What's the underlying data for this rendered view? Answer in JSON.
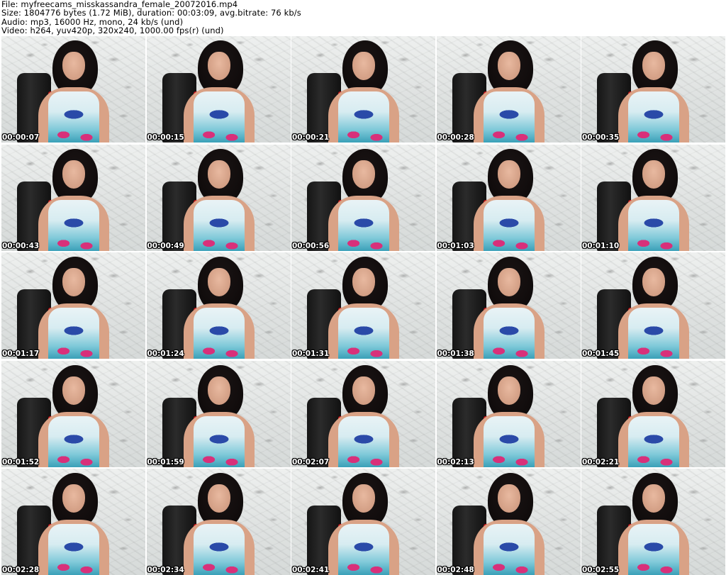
{
  "header": {
    "file_line": "File: myfreecams_misskassandra_female_20072016.mp4",
    "size_line": "Size: 1804776 bytes (1.72 MiB), duration: 00:03:09, avg.bitrate: 76 kb/s",
    "audio_line": "Audio: mp3, 16000 Hz, mono, 24 kb/s (und)",
    "video_line": "Video: h264, yuv420p, 320x240, 1000.00 fps(r) (und)"
  },
  "thumbnails": [
    {
      "timestamp": "00:00:07"
    },
    {
      "timestamp": "00:00:15"
    },
    {
      "timestamp": "00:00:21"
    },
    {
      "timestamp": "00:00:28"
    },
    {
      "timestamp": "00:00:35"
    },
    {
      "timestamp": "00:00:43"
    },
    {
      "timestamp": "00:00:49"
    },
    {
      "timestamp": "00:00:56"
    },
    {
      "timestamp": "00:01:03"
    },
    {
      "timestamp": "00:01:10"
    },
    {
      "timestamp": "00:01:17"
    },
    {
      "timestamp": "00:01:24"
    },
    {
      "timestamp": "00:01:31"
    },
    {
      "timestamp": "00:01:38"
    },
    {
      "timestamp": "00:01:45"
    },
    {
      "timestamp": "00:01:52"
    },
    {
      "timestamp": "00:01:59"
    },
    {
      "timestamp": "00:02:07"
    },
    {
      "timestamp": "00:02:13"
    },
    {
      "timestamp": "00:02:21"
    },
    {
      "timestamp": "00:02:28"
    },
    {
      "timestamp": "00:02:34"
    },
    {
      "timestamp": "00:02:41"
    },
    {
      "timestamp": "00:02:48"
    },
    {
      "timestamp": "00:02:55"
    }
  ]
}
